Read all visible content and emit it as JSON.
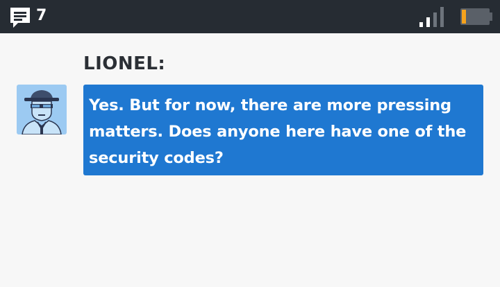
{
  "status_bar": {
    "message_icon": "chat-bubble-icon",
    "message_count": "7",
    "signal_icon": "signal-strength-icon",
    "battery_icon": "battery-icon",
    "battery_level": 0.15,
    "colors": {
      "background": "#262c33",
      "battery_fill": "#f5a21c"
    }
  },
  "dialogue": {
    "speaker": "LIONEL:",
    "avatar_icon": "man-with-hat-portrait-icon",
    "text": "Yes. But for now, there are more pressing matters. Does anyone here have one of the security codes?",
    "colors": {
      "bubble": "#1f78d1",
      "text": "#ffffff",
      "avatar_background": "#9ccaf2"
    }
  }
}
